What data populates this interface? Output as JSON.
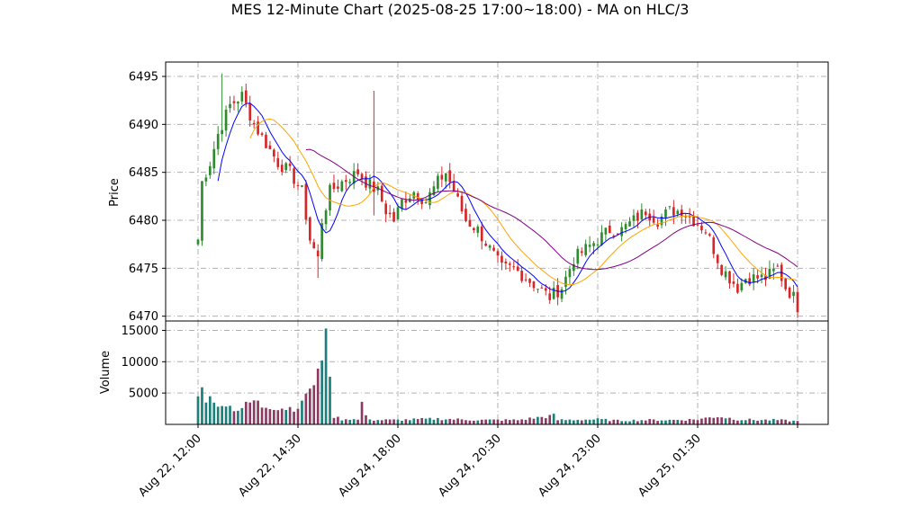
{
  "chart_data": {
    "type": "candlestick",
    "title": "MES 12-Minute Chart (2025-08-25 17:00~18:00) - MA on HLC/3",
    "price_panel": {
      "ylabel": "Price",
      "ylim": [
        6469.5,
        6496.5
      ],
      "yticks": [
        6470,
        6475,
        6480,
        6485,
        6490,
        6495
      ],
      "grid": true
    },
    "volume_panel": {
      "ylabel": "Volume",
      "ylim": [
        0,
        16500
      ],
      "yticks": [
        5000,
        10000,
        15000
      ],
      "grid": true
    },
    "x_tick_labels": [
      "Aug 22, 12:00",
      "Aug 22, 14:30",
      "Aug 24, 18:00",
      "Aug 24, 20:30",
      "Aug 24, 23:00",
      "Aug 25, 01:30"
    ],
    "x_tick_bar_index": [
      0,
      25,
      50,
      75,
      100,
      125
    ],
    "bar_count": 151,
    "colors": {
      "up": "#2e8b2e",
      "down": "#d62728",
      "vol_up": "#1b7f7a",
      "vol_down": "#8b3a62",
      "ma_fast": "#0000ff",
      "ma_mid": "#ffa500",
      "ma_slow": "#800080"
    },
    "close_anchors": [
      [
        0,
        6478
      ],
      [
        1,
        6484
      ],
      [
        3,
        6486
      ],
      [
        5,
        6489
      ],
      [
        8,
        6492
      ],
      [
        11,
        6493
      ],
      [
        14,
        6490
      ],
      [
        17,
        6488
      ],
      [
        20,
        6486
      ],
      [
        23,
        6485
      ],
      [
        26,
        6483
      ],
      [
        28,
        6478
      ],
      [
        30,
        6476
      ],
      [
        31,
        6480
      ],
      [
        33,
        6483
      ],
      [
        36,
        6484
      ],
      [
        40,
        6485
      ],
      [
        42,
        6484
      ],
      [
        45,
        6483
      ],
      [
        47,
        6481
      ],
      [
        49,
        6480
      ],
      [
        51,
        6482
      ],
      [
        54,
        6483
      ],
      [
        57,
        6482
      ],
      [
        60,
        6484
      ],
      [
        62,
        6485
      ],
      [
        64,
        6483
      ],
      [
        67,
        6480
      ],
      [
        70,
        6479
      ],
      [
        73,
        6477
      ],
      [
        76,
        6475
      ],
      [
        79,
        6475
      ],
      [
        82,
        6474
      ],
      [
        85,
        6473
      ],
      [
        88,
        6472
      ],
      [
        91,
        6473
      ],
      [
        94,
        6476
      ],
      [
        97,
        6477
      ],
      [
        100,
        6478
      ],
      [
        103,
        6479
      ],
      [
        106,
        6479
      ],
      [
        109,
        6480
      ],
      [
        112,
        6481
      ],
      [
        115,
        6480
      ],
      [
        118,
        6481
      ],
      [
        121,
        6481
      ],
      [
        124,
        6480
      ],
      [
        127,
        6479
      ],
      [
        129,
        6477
      ],
      [
        131,
        6475
      ],
      [
        133,
        6474
      ],
      [
        135,
        6473
      ],
      [
        137,
        6474
      ],
      [
        139,
        6474
      ],
      [
        142,
        6474
      ],
      [
        145,
        6475
      ],
      [
        147,
        6473
      ],
      [
        149,
        6472
      ],
      [
        150,
        6471
      ]
    ],
    "volume_anchors": [
      [
        0,
        5600
      ],
      [
        1,
        5300
      ],
      [
        2,
        4200
      ],
      [
        3,
        5500
      ],
      [
        4,
        3000
      ],
      [
        5,
        2600
      ],
      [
        6,
        3900
      ],
      [
        8,
        2800
      ],
      [
        10,
        2400
      ],
      [
        12,
        3000
      ],
      [
        14,
        3800
      ],
      [
        16,
        2900
      ],
      [
        18,
        3000
      ],
      [
        20,
        2700
      ],
      [
        22,
        2600
      ],
      [
        24,
        2700
      ],
      [
        26,
        3100
      ],
      [
        27,
        5300
      ],
      [
        28,
        6000
      ],
      [
        29,
        5800
      ],
      [
        30,
        7500
      ],
      [
        31,
        10200
      ],
      [
        32,
        15300
      ],
      [
        33,
        7600
      ],
      [
        34,
        1300
      ],
      [
        36,
        800
      ],
      [
        38,
        900
      ],
      [
        40,
        700
      ],
      [
        41,
        3600
      ],
      [
        42,
        1200
      ],
      [
        44,
        700
      ],
      [
        50,
        700
      ],
      [
        55,
        800
      ],
      [
        60,
        900
      ],
      [
        65,
        800
      ],
      [
        70,
        700
      ],
      [
        80,
        700
      ],
      [
        89,
        1400
      ],
      [
        90,
        700
      ],
      [
        100,
        800
      ],
      [
        105,
        600
      ],
      [
        112,
        700
      ],
      [
        118,
        700
      ],
      [
        125,
        800
      ],
      [
        130,
        1300
      ],
      [
        135,
        800
      ],
      [
        140,
        700
      ],
      [
        145,
        700
      ],
      [
        150,
        500
      ]
    ],
    "moving_averages": [
      {
        "color": "#0000ff",
        "window": 6
      },
      {
        "color": "#ffa500",
        "window": 14
      },
      {
        "color": "#800080",
        "window": 28
      }
    ]
  }
}
